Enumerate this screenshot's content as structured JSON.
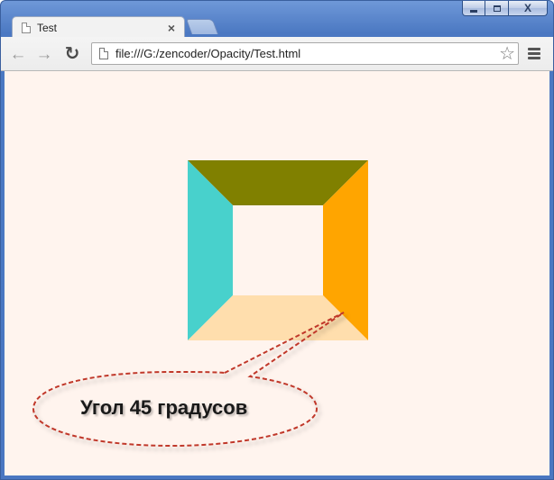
{
  "window": {
    "minimize_label": "minimize",
    "maximize_label": "maximize",
    "close_label": "X"
  },
  "tab": {
    "title": "Test",
    "close_glyph": "×"
  },
  "toolbar": {
    "back_glyph": "←",
    "forward_glyph": "→",
    "reload_glyph": "↻",
    "url": "file:///G:/zencoder/Opacity/Test.html",
    "star_glyph": "☆"
  },
  "page": {
    "background_color": "#fff4ee",
    "frame_colors": {
      "top": "#808000",
      "left": "#48d1cc",
      "right": "#ffa500",
      "bottom": "#ffdead"
    },
    "callout": {
      "text": "Угол 45 градусов",
      "border_color": "#c0392b"
    }
  },
  "icons": [
    "page-icon",
    "back-arrow-icon",
    "forward-arrow-icon",
    "reload-icon",
    "star-icon",
    "menu-icon",
    "close-icon"
  ]
}
